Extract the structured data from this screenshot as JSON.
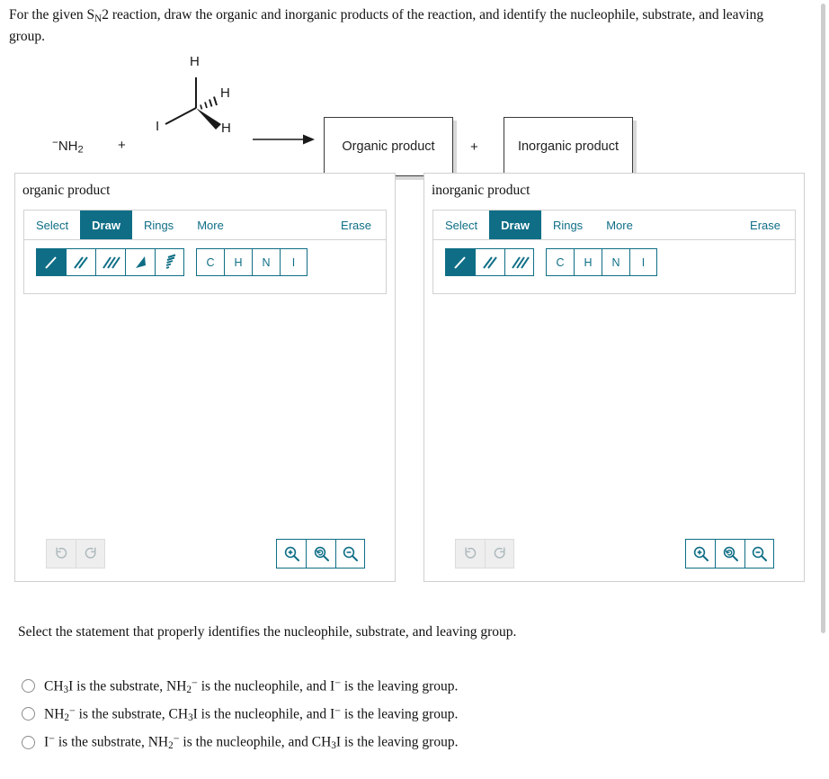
{
  "prompt": {
    "line1_a": "For the given S",
    "line1_sub": "N",
    "line1_b": "2 reaction, draw the organic and inorganic products of the reaction, and identify the nucleophile, substrate, and leaving group."
  },
  "scheme": {
    "reactant_nucleophile": {
      "charge": "−",
      "formula": "NH",
      "sub": "2"
    },
    "plus_between_reactants": "+",
    "substrate_atoms": {
      "top_h": "H",
      "right_h": "H",
      "bottom_h": "H",
      "halide": "I"
    },
    "arrow_icon": "reaction-arrow",
    "organic_product_label": "Organic product",
    "plus_between_products": "+",
    "inorganic_product_label": "Inorganic product"
  },
  "panels": [
    {
      "title": "organic product",
      "tabs": [
        {
          "label": "Select",
          "active": false
        },
        {
          "label": "Draw",
          "active": true
        },
        {
          "label": "Rings",
          "active": false
        },
        {
          "label": "More",
          "active": false
        }
      ],
      "erase_label": "Erase",
      "bond_tools": [
        {
          "name": "single-bond-tool",
          "selected": true
        },
        {
          "name": "double-bond-tool",
          "selected": false
        },
        {
          "name": "triple-bond-tool",
          "selected": false
        },
        {
          "name": "wedge-bond-tool",
          "selected": false
        },
        {
          "name": "hash-bond-tool",
          "selected": false
        }
      ],
      "atom_buttons": [
        "C",
        "H",
        "N",
        "I"
      ],
      "history": [
        {
          "name": "undo-button",
          "enabled": false
        },
        {
          "name": "redo-button",
          "enabled": false
        }
      ],
      "zoom_controls": [
        {
          "name": "zoom-in-button"
        },
        {
          "name": "zoom-reset-button"
        },
        {
          "name": "zoom-out-button"
        }
      ]
    },
    {
      "title": "inorganic product",
      "tabs": [
        {
          "label": "Select",
          "active": false
        },
        {
          "label": "Draw",
          "active": true
        },
        {
          "label": "Rings",
          "active": false
        },
        {
          "label": "More",
          "active": false
        }
      ],
      "erase_label": "Erase",
      "bond_tools": [
        {
          "name": "single-bond-tool",
          "selected": true
        },
        {
          "name": "double-bond-tool",
          "selected": false
        },
        {
          "name": "triple-bond-tool",
          "selected": false
        }
      ],
      "atom_buttons": [
        "C",
        "H",
        "N",
        "I"
      ],
      "history": [
        {
          "name": "undo-button",
          "enabled": false
        },
        {
          "name": "redo-button",
          "enabled": false
        }
      ],
      "zoom_controls": [
        {
          "name": "zoom-in-button"
        },
        {
          "name": "zoom-reset-button"
        },
        {
          "name": "zoom-out-button"
        }
      ]
    }
  ],
  "question": "Select the statement that properly identifies the nucleophile, substrate, and leaving group.",
  "options": [
    {
      "id": "option-1",
      "selected": false,
      "parts": [
        {
          "t": "CH"
        },
        {
          "sub": "3"
        },
        {
          "t": "I is the substrate, NH"
        },
        {
          "sub": "2"
        },
        {
          "sup": "−"
        },
        {
          "t": " is the nucleophile, and I"
        },
        {
          "sup": "−"
        },
        {
          "t": " is the leaving group."
        }
      ]
    },
    {
      "id": "option-2",
      "selected": false,
      "parts": [
        {
          "t": "NH"
        },
        {
          "sub": "2"
        },
        {
          "sup": "−"
        },
        {
          "t": " is the substrate, CH"
        },
        {
          "sub": "3"
        },
        {
          "t": "I is the nucleophile, and I"
        },
        {
          "sup": "−"
        },
        {
          "t": " is the leaving group."
        }
      ]
    },
    {
      "id": "option-3",
      "selected": false,
      "parts": [
        {
          "t": "I"
        },
        {
          "sup": "−"
        },
        {
          "t": " is the substrate, NH"
        },
        {
          "sub": "2"
        },
        {
          "sup": "−"
        },
        {
          "t": " is the nucleophile, and CH"
        },
        {
          "sub": "3"
        },
        {
          "t": "I is the leaving group."
        }
      ]
    }
  ],
  "colors": {
    "accent": "#0f6e86",
    "disabled": "#aeb9bd",
    "panel_border": "#cfcfcf",
    "text": "#111111"
  }
}
